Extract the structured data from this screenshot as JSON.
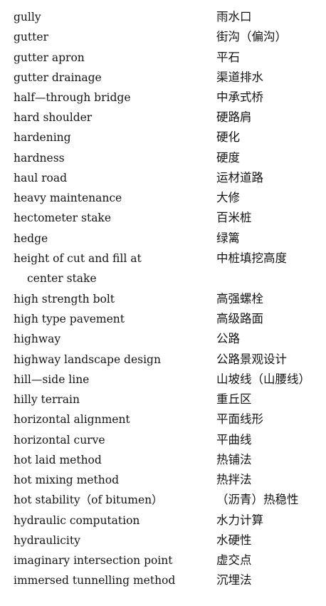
{
  "entries": [
    {
      "term": "gully",
      "translation": "雨水口"
    },
    {
      "term": "gutter",
      "translation": "街沟（偏沟）"
    },
    {
      "term": "gutter apron",
      "translation": "平石"
    },
    {
      "term": "gutter drainage",
      "translation": "渠道排水"
    },
    {
      "term": "half—through bridge",
      "translation": "中承式桥"
    },
    {
      "term": "hard shoulder",
      "translation": "硬路肩"
    },
    {
      "term": "hardening",
      "translation": "硬化"
    },
    {
      "term": "hardness",
      "translation": "硬度"
    },
    {
      "term": "haul road",
      "translation": "运材道路"
    },
    {
      "term": "heavy maintenance",
      "translation": "大修"
    },
    {
      "term": "hectometer stake",
      "translation": "百米桩"
    },
    {
      "term": "hedge",
      "translation": "绿篱"
    },
    {
      "term": "height of cut and fill at",
      "term_cont": "center stake",
      "translation": "中桩填挖高度"
    },
    {
      "term": "high strength bolt",
      "translation": "高强螺栓"
    },
    {
      "term": "high type pavement",
      "translation": "高级路面"
    },
    {
      "term": "highway",
      "translation": "公路"
    },
    {
      "term": "highway landscape design",
      "translation": "公路景观设计"
    },
    {
      "term": "hill—side line",
      "translation": "山坡线（山腰线）"
    },
    {
      "term": "hilly terrain",
      "translation": "重丘区"
    },
    {
      "term": "horizontal alignment",
      "translation": "平面线形"
    },
    {
      "term": "horizontal curve",
      "translation": "平曲线"
    },
    {
      "term": "hot laid method",
      "translation": "热铺法"
    },
    {
      "term": "hot mixing method",
      "translation": "热拌法"
    },
    {
      "term": "hot stability（of bitumen）",
      "translation": "（沥青）热稳性"
    },
    {
      "term": "hydraulic computation",
      "translation": "水力计算"
    },
    {
      "term": "hydraulicity",
      "translation": "水硬性"
    },
    {
      "term": "imaginary intersection point",
      "translation": "虚交点"
    },
    {
      "term": "immersed tunnelling method",
      "translation": "沉埋法"
    }
  ]
}
